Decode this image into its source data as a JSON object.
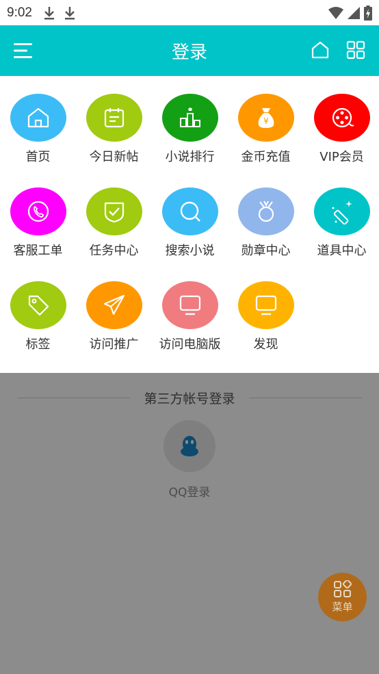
{
  "status_bar": {
    "time": "9:02"
  },
  "header": {
    "title": "登录"
  },
  "menu": {
    "items": [
      {
        "label": "首页",
        "color": "#3bbcf6",
        "icon": "home-icon"
      },
      {
        "label": "今日新帖",
        "color": "#a0cb10",
        "icon": "calendar-icon"
      },
      {
        "label": "小说排行",
        "color": "#14a014",
        "icon": "ranking-icon"
      },
      {
        "label": "金币充值",
        "color": "#ff9800",
        "icon": "money-bag-icon"
      },
      {
        "label": "VIP会员",
        "color": "#ff0000",
        "icon": "film-reel-icon"
      },
      {
        "label": "客服工单",
        "color": "#ff00ff",
        "icon": "phone-icon"
      },
      {
        "label": "任务中心",
        "color": "#a0cb10",
        "icon": "shield-check-icon"
      },
      {
        "label": "搜索小说",
        "color": "#3bbcf6",
        "icon": "search-icon"
      },
      {
        "label": "勋章中心",
        "color": "#90b6ec",
        "icon": "medal-icon"
      },
      {
        "label": "道具中心",
        "color": "#00c4c8",
        "icon": "magic-wand-icon"
      },
      {
        "label": "标签",
        "color": "#a0cb10",
        "icon": "tag-icon"
      },
      {
        "label": "访问推广",
        "color": "#ff9800",
        "icon": "paper-plane-icon"
      },
      {
        "label": "访问电脑版",
        "color": "#f07c80",
        "icon": "monitor-icon"
      },
      {
        "label": "发现",
        "color": "#ffb300",
        "icon": "monitor-icon"
      }
    ]
  },
  "third_party": {
    "title": "第三方帐号登录",
    "qq_label": "QQ登录"
  },
  "fab": {
    "label": "菜单"
  }
}
